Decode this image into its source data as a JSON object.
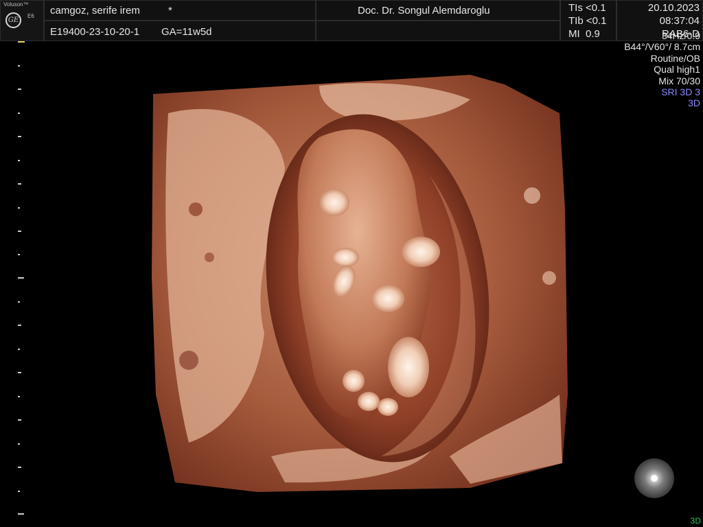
{
  "header": {
    "brand": "Voluson™",
    "model": "E6",
    "logo_text": "GE",
    "patient_name": "camgoz, serife irem",
    "marker": "*",
    "exam_id": "E19400-23-10-20-1",
    "gestational_age": "GA=11w5d",
    "doctor": "Doc. Dr. Songul Alemdaroglu",
    "indices": [
      {
        "label": "TIs",
        "value": "<0.1"
      },
      {
        "label": "TIb",
        "value": "<0.1"
      },
      {
        "label": "MI",
        "value": "0.9"
      }
    ],
    "date": "20.10.2023",
    "time": "08:37:04",
    "probe": "RAB6-D"
  },
  "params": {
    "frame_rate": "34Hz/0.9",
    "angles": "B44°/V60°/ 8.7cm",
    "preset": "Routine/OB",
    "quality": "Qual high1",
    "mix": "Mix 70/30",
    "sri": "SRI 3D 3",
    "mode": "3D"
  },
  "footer": {
    "mode_corner": "3D"
  },
  "colors": {
    "accent_blue": "#8a8aff",
    "corner_green": "#22c55e",
    "tissue_base": "#7a3220",
    "tissue_light": "#e8b59a"
  },
  "icons": {
    "light_source": "light-source-orb-icon",
    "logo": "ge-logo-icon"
  }
}
